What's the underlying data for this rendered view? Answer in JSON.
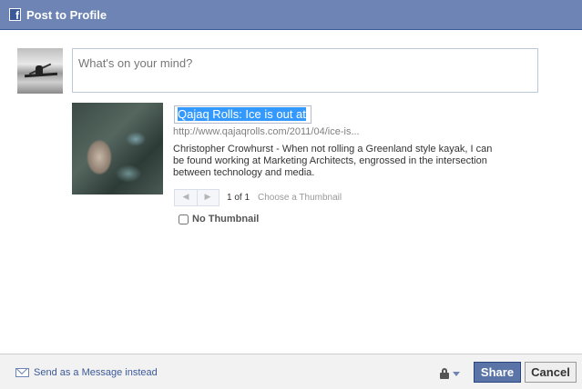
{
  "dialog": {
    "title": "Post to Profile",
    "brand_glyph": "f"
  },
  "composer": {
    "placeholder": "What's on your mind?"
  },
  "attachment": {
    "title": "Qajaq Rolls: Ice is out at",
    "url": "http://www.qajaqrolls.com/2011/04/ice-is...",
    "description": "Christopher Crowhurst - When not rolling a Greenland style kayak, I can be found working at Marketing Architects, engrossed in the intersection between technology and media.",
    "pager": {
      "prev_glyph": "◀",
      "next_glyph": "▶",
      "count": "1 of 1",
      "choose_label": "Choose a Thumbnail"
    },
    "no_thumbnail_label": "No Thumbnail",
    "no_thumbnail_checked": false
  },
  "footer": {
    "send_message_label": "Send as a Message instead",
    "share_label": "Share",
    "cancel_label": "Cancel"
  },
  "icons": {
    "brand": "facebook-icon",
    "message": "envelope-icon",
    "privacy": "lock-icon",
    "privacy_menu": "chevron-down-icon"
  },
  "colors": {
    "header": "#6d84b4",
    "link": "#3b5998",
    "selection": "#3399ff",
    "share_button": "#5b74a8"
  }
}
